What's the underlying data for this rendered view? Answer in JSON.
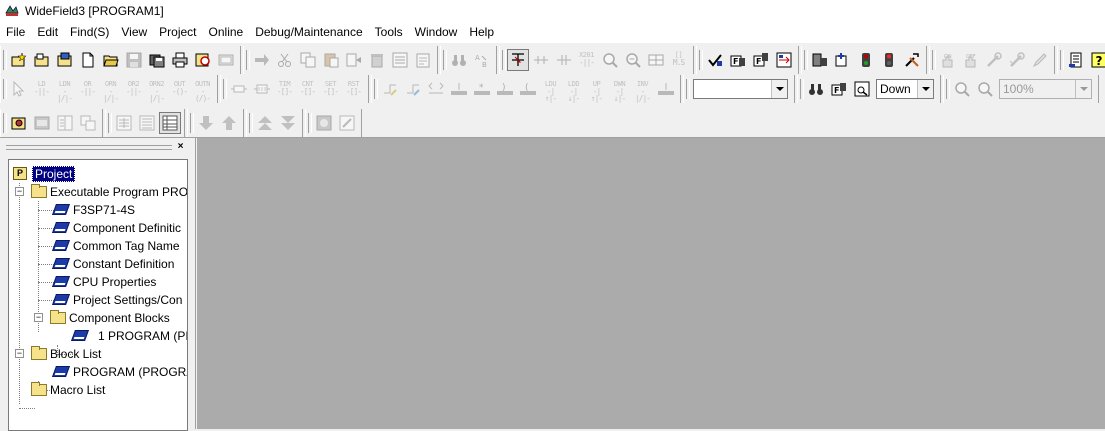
{
  "window": {
    "title": "WideField3 [PROGRAM1]"
  },
  "menu": [
    "File",
    "Edit",
    "Find(S)",
    "View",
    "Project",
    "Online",
    "Debug/Maintenance",
    "Tools",
    "Window",
    "Help"
  ],
  "toolbar": {
    "ladder_row1": [
      {
        "top": "LD",
        "bot": "-||-"
      },
      {
        "top": "LDN",
        "bot": "-|/|-"
      },
      {
        "top": "OR",
        "bot": "-||-"
      },
      {
        "top": "ORN",
        "bot": "-|/|-"
      },
      {
        "top": "OR2",
        "bot": "-||-"
      },
      {
        "top": "ORN2",
        "bot": "-|/|-"
      },
      {
        "top": "OUT",
        "bot": "-()-"
      },
      {
        "top": "OUTN",
        "bot": "-(/)-"
      }
    ],
    "ladder_row2": [
      {
        "top": "TIM",
        "bot": "-[]-"
      },
      {
        "top": "CNT",
        "bot": "-[]-"
      },
      {
        "top": "SET",
        "bot": "-[]-"
      },
      {
        "top": "RST",
        "bot": "-[]-"
      }
    ],
    "ladder_row3": [
      {
        "top": "LDU",
        "bot": "-|↑|-"
      },
      {
        "top": "LDD",
        "bot": "-|↓|-"
      },
      {
        "top": "UP",
        "bot": "-|↑|-"
      },
      {
        "top": "DWN",
        "bot": "-|↓|-"
      },
      {
        "top": "INV",
        "bot": "-|/|-"
      }
    ],
    "search_combo_value": "",
    "direction_combo_value": "Down",
    "zoom_combo_value": "100%"
  },
  "tree": {
    "items": [
      {
        "label": "Project",
        "icon": "project-icon",
        "level": 0,
        "selected": true
      },
      {
        "label": "Executable Program PRO",
        "icon": "folder-icon",
        "level": 1,
        "expand": "−"
      },
      {
        "label": "F3SP71-4S",
        "icon": "book-icon",
        "level": 2
      },
      {
        "label": "Component Definitic",
        "icon": "book-icon",
        "level": 2
      },
      {
        "label": "Common Tag Name",
        "icon": "book-icon",
        "level": 2
      },
      {
        "label": "Constant Definition",
        "icon": "book-icon",
        "level": 2
      },
      {
        "label": "CPU Properties",
        "icon": "book-icon",
        "level": 2
      },
      {
        "label": "Project Settings/Con",
        "icon": "book-icon",
        "level": 2
      },
      {
        "label": "Component Blocks",
        "icon": "folder-icon",
        "level": 2,
        "expand": "−"
      },
      {
        "label": "1 PROGRAM (PI",
        "icon": "book-icon",
        "level": 3
      },
      {
        "label": "Block List",
        "icon": "folder-icon",
        "level": 1,
        "expand": "−"
      },
      {
        "label": "PROGRAM (PROGRA",
        "icon": "book-icon",
        "level": 2
      },
      {
        "label": "Macro List",
        "icon": "folder-icon",
        "level": 1
      }
    ]
  },
  "colors": {
    "workspace": "#ababab",
    "selection": "#000080",
    "folder": "#f5e28a",
    "book": "#1c3aa8"
  }
}
